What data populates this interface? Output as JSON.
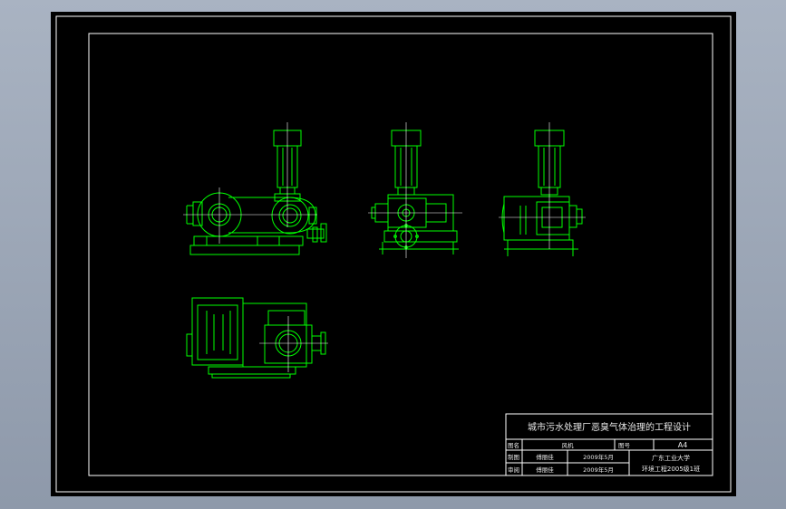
{
  "colors": {
    "background": "#000000",
    "frame": "#ffffff",
    "part_lines": "#00ff00",
    "center_lines": "#ffffff",
    "text": "#e8e8e8"
  },
  "title_block": {
    "title": "城市污水处理厂恶臭气体治理的工程设计",
    "label_drawing_name": "图名",
    "drawing_name": "风机",
    "label_drawing_number": "图号",
    "drawing_number": "A4",
    "label_drafted": "制图",
    "drafter": "傅丽佳",
    "date_drafted": "2009年5月",
    "label_review": "审阅",
    "reviewer": "傅丽佳",
    "date_review": "2009年5月",
    "school": "广东工业大学",
    "class_name": "环境工程2005级1班"
  }
}
